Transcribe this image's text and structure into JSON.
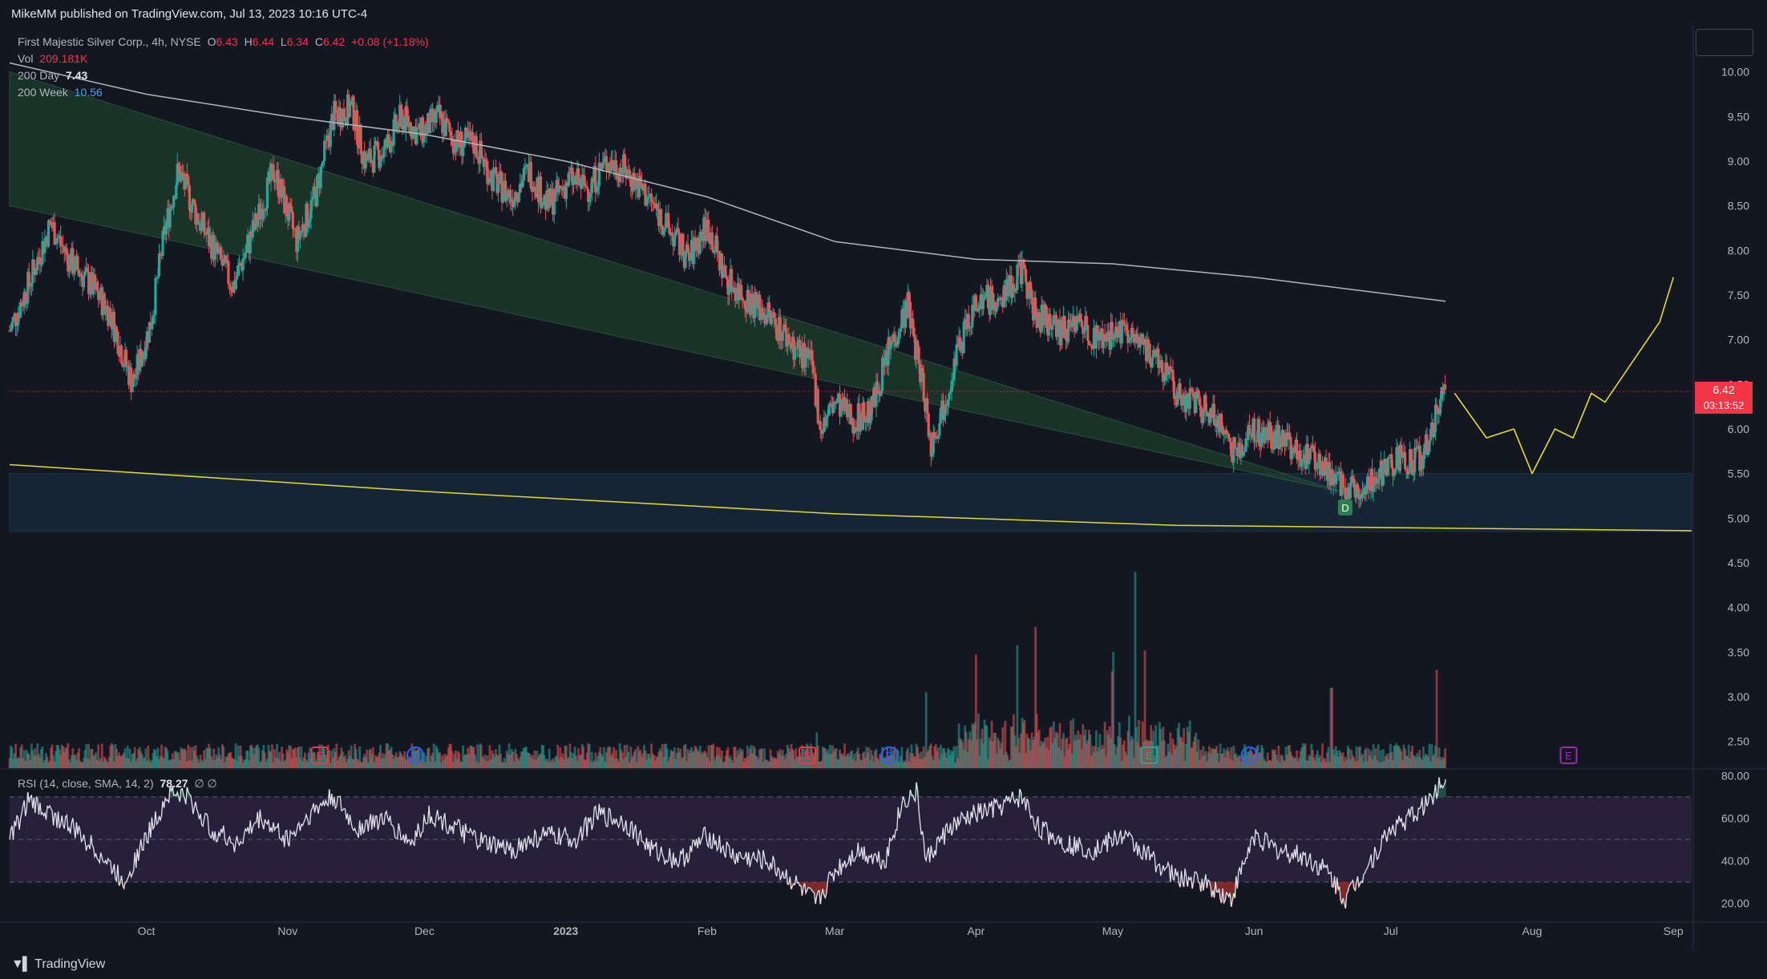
{
  "header": {
    "published_by": "MikeMM published on TradingView.com, Jul 13, 2023 10:16 UTC-4"
  },
  "legend": {
    "symbol": "First Majestic Silver Corp., 4h, NYSE",
    "open_label": "O",
    "open": "6.43",
    "high_label": "H",
    "high": "6.44",
    "low_label": "L",
    "low": "6.34",
    "close_label": "C",
    "close": "6.42",
    "change": "+0.08 (+1.18%)",
    "vol_label": "Vol",
    "vol_value": "209.181K",
    "ma200d_label": "200 Day",
    "ma200d_value": "7.43",
    "ma200w_label": "200 Week",
    "ma200w_value": "10.56",
    "rsi_label": "RSI (14, close, SMA, 14, 2)",
    "rsi_value": "78.27",
    "rsi_extra": "∅ ∅"
  },
  "last_price": {
    "price": "6.42",
    "countdown": "03:13:52"
  },
  "footer": {
    "brand": "TradingView"
  },
  "colors": {
    "up": "#26a69a",
    "down": "#ef5350",
    "ma200d": "#b2b5be",
    "ma200w": "#e6d832",
    "projection": "#e6d832",
    "channel_fill": "#1f4a2e",
    "support_zone": "#1a3244",
    "rsi_band": "#2a2240",
    "rsi_line": "#e0e3eb",
    "price_line": "#f23645"
  },
  "chart_data": [
    {
      "type": "candlestick",
      "title": "First Majestic Silver Corp., 4h, NYSE",
      "y_axis_ticks": [
        10.0,
        9.5,
        9.0,
        8.5,
        8.0,
        7.5,
        7.0,
        6.5,
        6.0,
        5.5,
        5.0,
        4.5,
        4.0,
        3.5,
        3.0,
        2.5
      ],
      "ylim": [
        2.2,
        10.5
      ],
      "x_axis_ticks": [
        "Oct",
        "Nov",
        "Dec",
        "2023",
        "Feb",
        "Mar",
        "Apr",
        "May",
        "Jun",
        "Jul",
        "Aug",
        "Sep"
      ],
      "x_range": [
        "2022-09-01",
        "2023-09-05"
      ],
      "price_path": [
        [
          "2022-09-01",
          7.1
        ],
        [
          "2022-09-05",
          7.6
        ],
        [
          "2022-09-10",
          8.3
        ],
        [
          "2022-09-14",
          7.9
        ],
        [
          "2022-09-19",
          7.6
        ],
        [
          "2022-09-23",
          7.3
        ],
        [
          "2022-09-26",
          6.8
        ],
        [
          "2022-09-28",
          6.5
        ],
        [
          "2022-10-02",
          7.2
        ],
        [
          "2022-10-05",
          8.2
        ],
        [
          "2022-10-08",
          8.9
        ],
        [
          "2022-10-12",
          8.4
        ],
        [
          "2022-10-16",
          8.0
        ],
        [
          "2022-10-20",
          7.6
        ],
        [
          "2022-10-25",
          8.3
        ],
        [
          "2022-10-29",
          8.9
        ],
        [
          "2022-11-03",
          8.1
        ],
        [
          "2022-11-07",
          8.6
        ],
        [
          "2022-11-11",
          9.5
        ],
        [
          "2022-11-15",
          9.6
        ],
        [
          "2022-11-18",
          9.0
        ],
        [
          "2022-11-22",
          9.1
        ],
        [
          "2022-11-26",
          9.5
        ],
        [
          "2022-11-30",
          9.3
        ],
        [
          "2022-12-04",
          9.5
        ],
        [
          "2022-12-08",
          9.2
        ],
        [
          "2022-12-12",
          9.2
        ],
        [
          "2022-12-16",
          8.8
        ],
        [
          "2022-12-20",
          8.6
        ],
        [
          "2022-12-24",
          8.9
        ],
        [
          "2022-12-28",
          8.5
        ],
        [
          "2023-01-02",
          8.8
        ],
        [
          "2023-01-06",
          8.7
        ],
        [
          "2023-01-10",
          9.0
        ],
        [
          "2023-01-14",
          8.9
        ],
        [
          "2023-01-19",
          8.6
        ],
        [
          "2023-01-24",
          8.2
        ],
        [
          "2023-01-28",
          7.9
        ],
        [
          "2023-02-01",
          8.3
        ],
        [
          "2023-02-05",
          7.7
        ],
        [
          "2023-02-09",
          7.5
        ],
        [
          "2023-02-14",
          7.3
        ],
        [
          "2023-02-19",
          7.0
        ],
        [
          "2023-02-24",
          6.7
        ],
        [
          "2023-02-26",
          6.0
        ],
        [
          "2023-03-01",
          6.3
        ],
        [
          "2023-03-05",
          6.1
        ],
        [
          "2023-03-09",
          6.2
        ],
        [
          "2023-03-13",
          6.9
        ],
        [
          "2023-03-17",
          7.4
        ],
        [
          "2023-03-21",
          6.3
        ],
        [
          "2023-03-22",
          5.8
        ],
        [
          "2023-03-25",
          6.3
        ],
        [
          "2023-03-28",
          6.9
        ],
        [
          "2023-04-02",
          7.5
        ],
        [
          "2023-04-06",
          7.4
        ],
        [
          "2023-04-11",
          7.8
        ],
        [
          "2023-04-14",
          7.3
        ],
        [
          "2023-04-19",
          7.1
        ],
        [
          "2023-04-24",
          7.2
        ],
        [
          "2023-04-28",
          7.0
        ],
        [
          "2023-05-03",
          7.1
        ],
        [
          "2023-05-07",
          6.9
        ],
        [
          "2023-05-11",
          6.8
        ],
        [
          "2023-05-15",
          6.4
        ],
        [
          "2023-05-19",
          6.3
        ],
        [
          "2023-05-24",
          6.1
        ],
        [
          "2023-05-28",
          5.7
        ],
        [
          "2023-06-01",
          6.0
        ],
        [
          "2023-06-05",
          5.9
        ],
        [
          "2023-06-09",
          5.8
        ],
        [
          "2023-06-13",
          5.7
        ],
        [
          "2023-06-17",
          5.5
        ],
        [
          "2023-06-21",
          5.3
        ],
        [
          "2023-06-25",
          5.4
        ],
        [
          "2023-06-29",
          5.5
        ],
        [
          "2023-07-03",
          5.7
        ],
        [
          "2023-07-06",
          5.6
        ],
        [
          "2023-07-09",
          5.8
        ],
        [
          "2023-07-11",
          6.2
        ],
        [
          "2023-07-13",
          6.42
        ]
      ],
      "ma200_day": [
        [
          "2022-09-01",
          10.1
        ],
        [
          "2022-10-01",
          9.75
        ],
        [
          "2022-11-01",
          9.5
        ],
        [
          "2022-12-01",
          9.3
        ],
        [
          "2023-01-01",
          9.0
        ],
        [
          "2023-02-01",
          8.6
        ],
        [
          "2023-03-01",
          8.1
        ],
        [
          "2023-04-01",
          7.9
        ],
        [
          "2023-05-01",
          7.85
        ],
        [
          "2023-06-01",
          7.7
        ],
        [
          "2023-07-13",
          7.43
        ]
      ],
      "ma200_week": [
        [
          "2022-09-01",
          5.6
        ],
        [
          "2022-12-01",
          5.3
        ],
        [
          "2023-03-01",
          5.05
        ],
        [
          "2023-05-15",
          4.92
        ],
        [
          "2023-09-05",
          4.86
        ]
      ],
      "projection": [
        [
          "2023-07-15",
          6.4
        ],
        [
          "2023-07-22",
          5.9
        ],
        [
          "2023-07-28",
          6.0
        ],
        [
          "2023-08-01",
          5.5
        ],
        [
          "2023-08-06",
          6.0
        ],
        [
          "2023-08-10",
          5.9
        ],
        [
          "2023-08-14",
          6.4
        ],
        [
          "2023-08-17",
          6.3
        ],
        [
          "2023-08-21",
          6.6
        ],
        [
          "2023-08-29",
          7.2
        ],
        [
          "2023-09-01",
          7.7
        ]
      ],
      "current_price": 6.42,
      "support_zone": [
        4.85,
        5.5
      ],
      "channel": {
        "upper": [
          [
            "2022-09-01",
            10.0
          ],
          [
            "2023-06-20",
            5.3
          ]
        ],
        "lower": [
          [
            "2022-09-01",
            8.5
          ],
          [
            "2023-06-20",
            5.3
          ]
        ]
      },
      "markers": [
        {
          "date": "2023-06-21",
          "label": "D",
          "color": "#2e7d4f"
        }
      ],
      "events": [
        {
          "date": "2022-11-08",
          "label": "E",
          "color": "#f23645"
        },
        {
          "date": "2022-11-29",
          "label": "D",
          "color": "#2962ff"
        },
        {
          "date": "2023-02-23",
          "label": "E",
          "color": "#f23645"
        },
        {
          "date": "2023-03-13",
          "label": "D",
          "color": "#2962ff"
        },
        {
          "date": "2023-05-09",
          "label": "E",
          "color": "#26a69a"
        },
        {
          "date": "2023-05-31",
          "label": "D",
          "color": "#2962ff"
        },
        {
          "date": "2023-08-09",
          "label": "E",
          "color": "#9c27b0"
        }
      ]
    },
    {
      "type": "bar",
      "title": "Volume",
      "volume_scale_note": "bars rise from 2.2 baseline on price axis",
      "spikes": [
        [
          "2023-04-01",
          3.4
        ],
        [
          "2023-04-10",
          3.5
        ],
        [
          "2023-04-14",
          3.45
        ],
        [
          "2023-05-01",
          3.2
        ],
        [
          "2023-05-06",
          4.2
        ],
        [
          "2023-05-08",
          3.3
        ],
        [
          "2023-06-18",
          3.1
        ],
        [
          "2023-07-11",
          3.3
        ],
        [
          "2023-03-21",
          3.05
        ],
        [
          "2023-02-25",
          2.6
        ]
      ]
    },
    {
      "type": "line",
      "title": "RSI (14, close, SMA, 14, 2)",
      "y_axis_ticks": [
        80.0,
        60.0,
        40.0,
        20.0
      ],
      "ylim": [
        12,
        82
      ],
      "bands": [
        30,
        50,
        70
      ],
      "values": [
        [
          "2022-09-01",
          50
        ],
        [
          "2022-09-05",
          68
        ],
        [
          "2022-09-10",
          62
        ],
        [
          "2022-09-15",
          55
        ],
        [
          "2022-09-20",
          45
        ],
        [
          "2022-09-26",
          30
        ],
        [
          "2022-10-02",
          55
        ],
        [
          "2022-10-06",
          72
        ],
        [
          "2022-10-10",
          70
        ],
        [
          "2022-10-15",
          55
        ],
        [
          "2022-10-21",
          48
        ],
        [
          "2022-10-26",
          60
        ],
        [
          "2022-11-01",
          50
        ],
        [
          "2022-11-06",
          62
        ],
        [
          "2022-11-11",
          70
        ],
        [
          "2022-11-16",
          55
        ],
        [
          "2022-11-22",
          60
        ],
        [
          "2022-11-28",
          48
        ],
        [
          "2022-12-02",
          62
        ],
        [
          "2022-12-08",
          55
        ],
        [
          "2022-12-14",
          48
        ],
        [
          "2022-12-20",
          45
        ],
        [
          "2022-12-27",
          52
        ],
        [
          "2023-01-03",
          50
        ],
        [
          "2023-01-08",
          62
        ],
        [
          "2023-01-14",
          58
        ],
        [
          "2023-01-20",
          45
        ],
        [
          "2023-01-26",
          40
        ],
        [
          "2023-02-01",
          52
        ],
        [
          "2023-02-07",
          42
        ],
        [
          "2023-02-14",
          40
        ],
        [
          "2023-02-20",
          30
        ],
        [
          "2023-02-25",
          20
        ],
        [
          "2023-03-01",
          35
        ],
        [
          "2023-03-06",
          45
        ],
        [
          "2023-03-12",
          40
        ],
        [
          "2023-03-16",
          68
        ],
        [
          "2023-03-19",
          72
        ],
        [
          "2023-03-21",
          40
        ],
        [
          "2023-03-26",
          55
        ],
        [
          "2023-04-01",
          62
        ],
        [
          "2023-04-06",
          65
        ],
        [
          "2023-04-11",
          70
        ],
        [
          "2023-04-15",
          55
        ],
        [
          "2023-04-21",
          48
        ],
        [
          "2023-04-27",
          45
        ],
        [
          "2023-05-03",
          52
        ],
        [
          "2023-05-09",
          42
        ],
        [
          "2023-05-15",
          32
        ],
        [
          "2023-05-21",
          30
        ],
        [
          "2023-05-27",
          22
        ],
        [
          "2023-06-01",
          52
        ],
        [
          "2023-06-06",
          45
        ],
        [
          "2023-06-12",
          42
        ],
        [
          "2023-06-17",
          35
        ],
        [
          "2023-06-21",
          22
        ],
        [
          "2023-06-26",
          38
        ],
        [
          "2023-07-01",
          55
        ],
        [
          "2023-07-05",
          60
        ],
        [
          "2023-07-08",
          65
        ],
        [
          "2023-07-13",
          78.27
        ]
      ],
      "current_value": 78.27
    }
  ]
}
